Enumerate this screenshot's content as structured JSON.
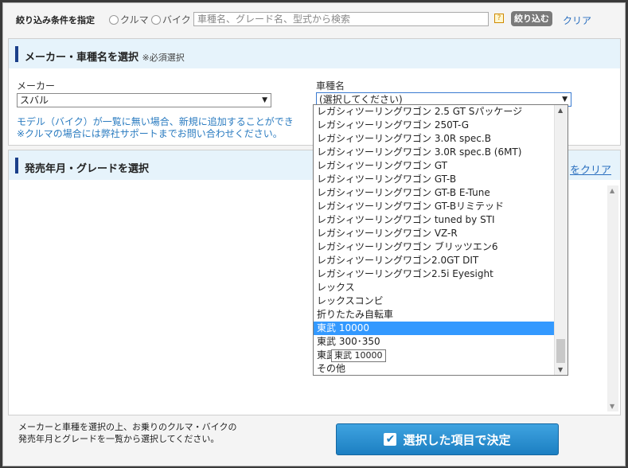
{
  "filter": {
    "label": "絞り込み条件を指定",
    "radio_car": "クルマ",
    "radio_bike": "バイク",
    "search_placeholder": "車種名、グレード名、型式から検索",
    "help_icon": "?",
    "filter_button": "絞り込む",
    "clear_link": "クリア"
  },
  "maker_section": {
    "title": "メーカー・車種名を選択",
    "note": "※必須選択",
    "maker_label": "メーカー",
    "maker_value": "スバル",
    "model_label": "車種名",
    "model_value": "(選択してください)",
    "note_line1": "モデル（バイク）が一覧に無い場合、新規に追加することができ",
    "note_line2": "※クルマの場合には弊社サポートまでお問い合わせください。"
  },
  "grade_section": {
    "title": "発売年月・グレードを選択",
    "clear_link": "をクリア"
  },
  "dropdown": {
    "items": [
      "レガシィツーリングワゴン 2.5 GT Sパッケージ",
      "レガシィツーリングワゴン 250T-G",
      "レガシィツーリングワゴン 3.0R spec.B",
      "レガシィツーリングワゴン 3.0R spec.B (6MT)",
      "レガシィツーリングワゴン GT",
      "レガシィツーリングワゴン GT-B",
      "レガシィツーリングワゴン GT-B E-Tune",
      "レガシィツーリングワゴン GT-Bリミテッド",
      "レガシィツーリングワゴン tuned by STI",
      "レガシィツーリングワゴン VZ-R",
      "レガシィツーリングワゴン ブリッツエン6",
      "レガシィツーリングワゴン2.0GT DIT",
      "レガシィツーリングワゴン2.5i Eyesight",
      "レックス",
      "レックスコンビ",
      "折りたたみ自転車",
      "東武 10000",
      "東武 300･350",
      "東武",
      "その他"
    ],
    "selected_index": 16,
    "tooltip": "東武 10000"
  },
  "footer": {
    "note_line1": "メーカーと車種を選択の上、お乗りのクルマ・バイクの",
    "note_line2": "発売年月とグレードを一覧から選択してください。",
    "confirm_button": "選択した項目で決定"
  },
  "colors": {
    "accent_blue": "#1c7fc2",
    "selection": "#3399ff",
    "section_bar": "#1a3f8a",
    "link": "#2a6fbf"
  }
}
